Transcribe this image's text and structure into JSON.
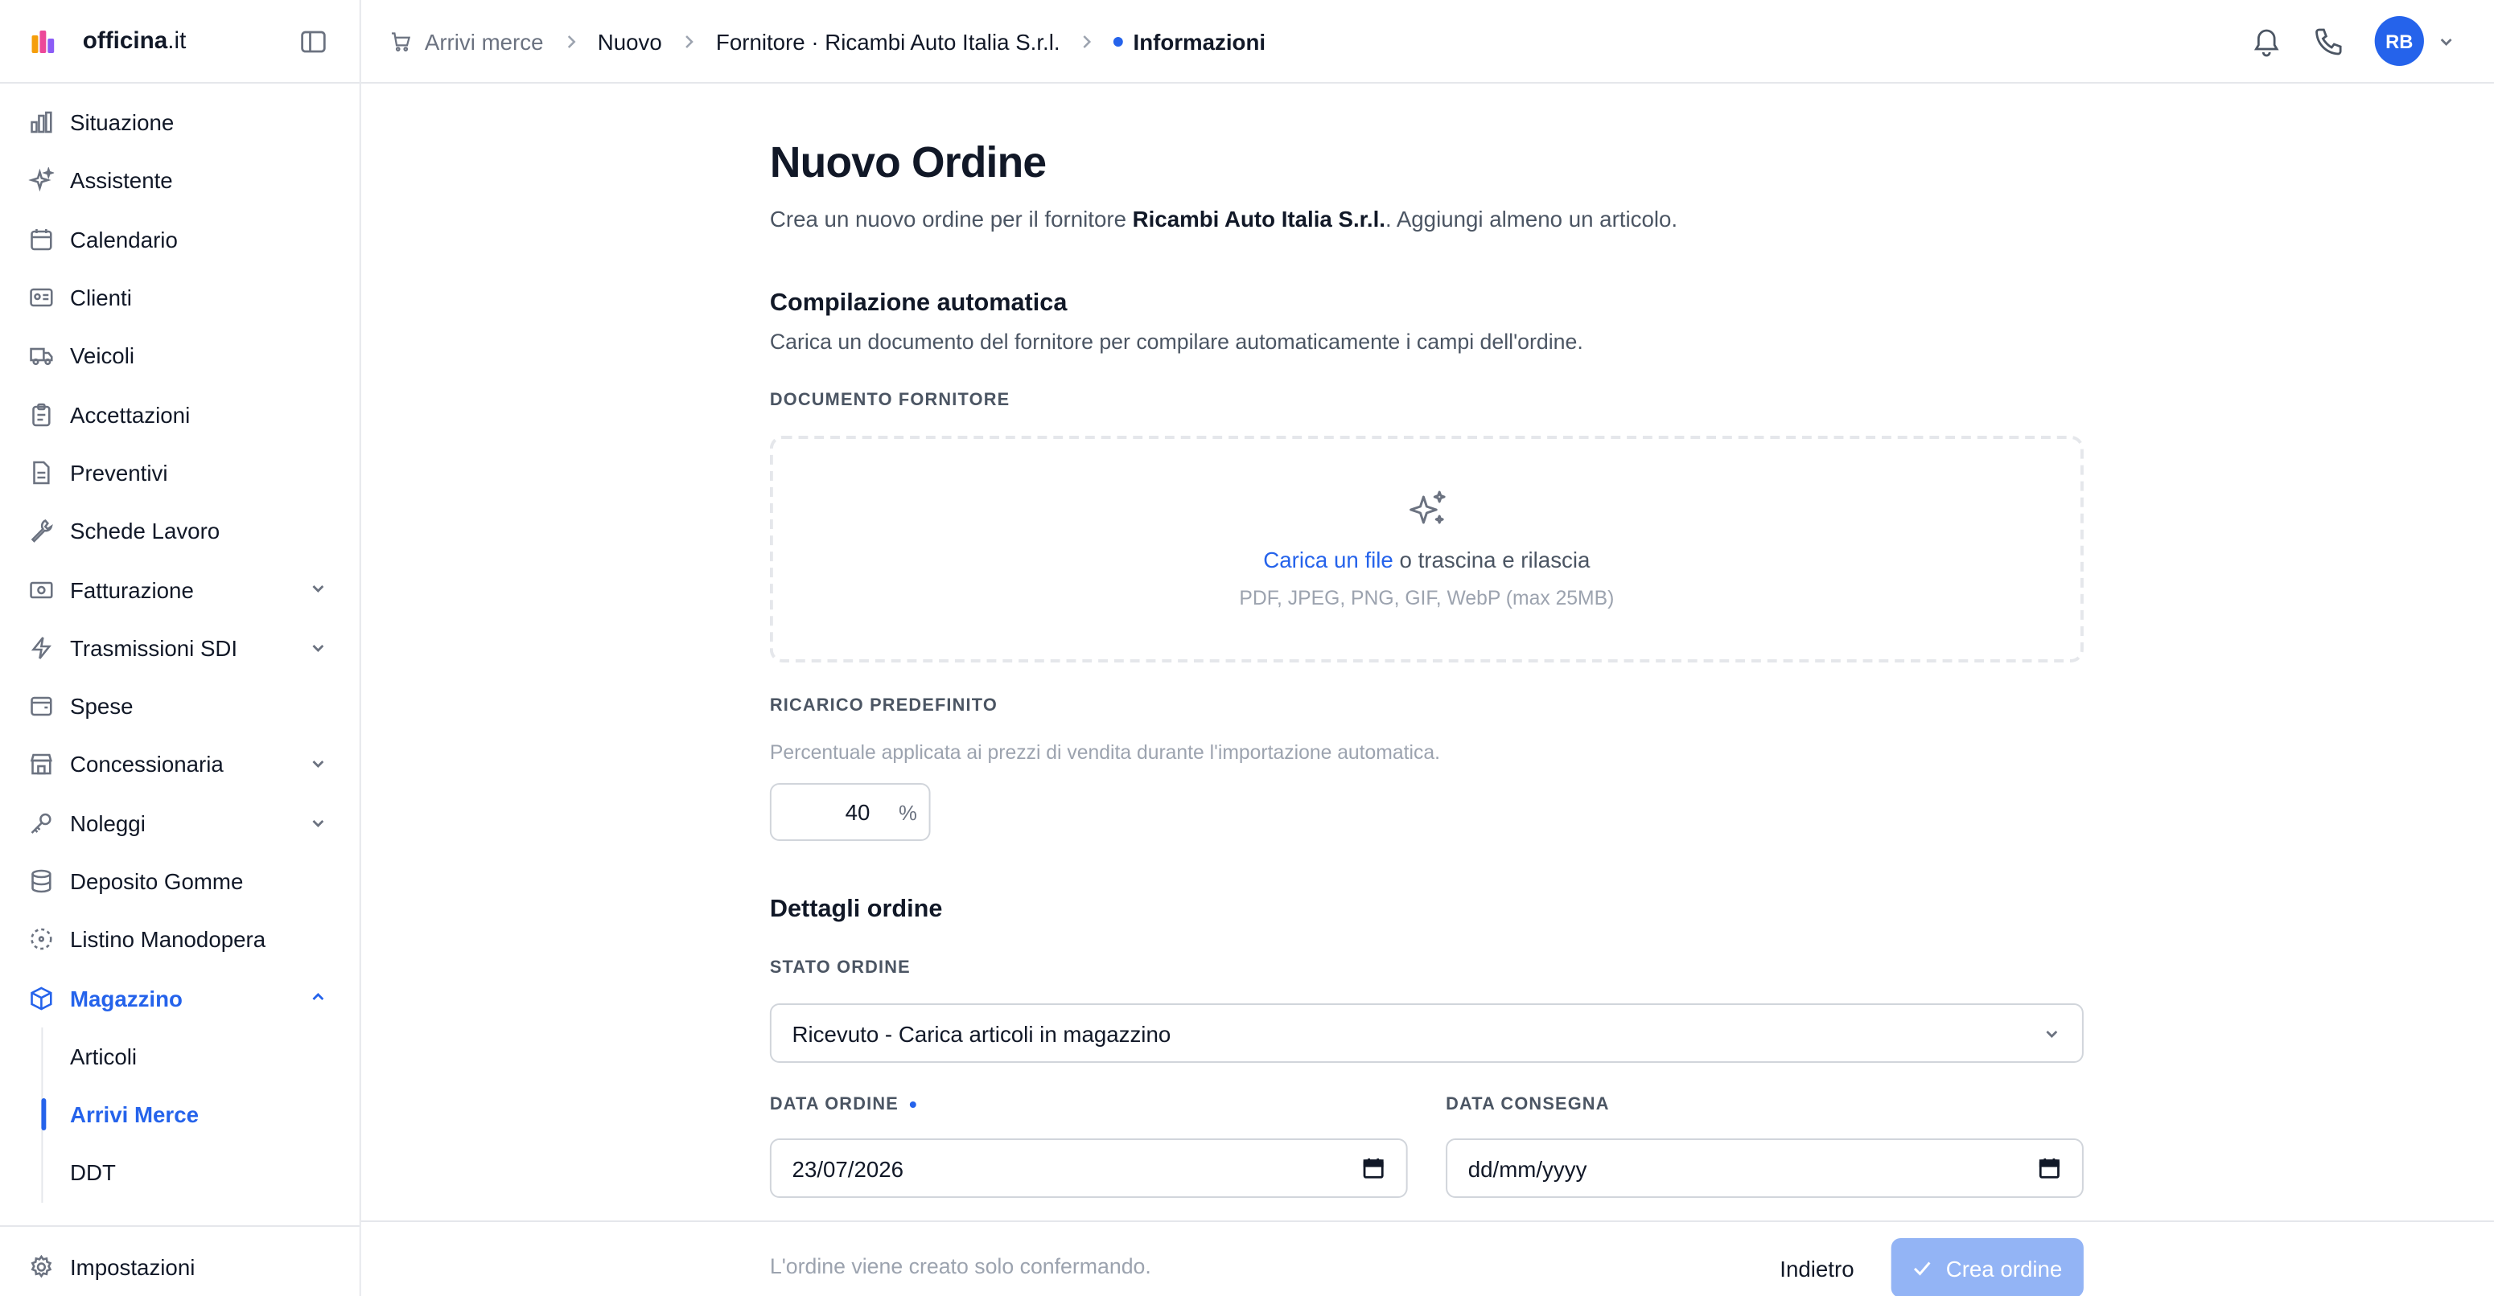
{
  "app": {
    "name": "officina",
    "tld": ".it"
  },
  "sidebar": {
    "items": [
      {
        "label": "Situazione",
        "icon": "bar-chart-icon"
      },
      {
        "label": "Assistente",
        "icon": "sparkles-icon"
      },
      {
        "label": "Calendario",
        "icon": "calendar-icon"
      },
      {
        "label": "Clienti",
        "icon": "id-card-icon"
      },
      {
        "label": "Veicoli",
        "icon": "truck-icon"
      },
      {
        "label": "Accettazioni",
        "icon": "clipboard-icon"
      },
      {
        "label": "Preventivi",
        "icon": "file-icon"
      },
      {
        "label": "Schede Lavoro",
        "icon": "wrench-icon"
      },
      {
        "label": "Fatturazione",
        "icon": "banknote-icon",
        "expandable": true
      },
      {
        "label": "Trasmissioni SDI",
        "icon": "bolt-icon",
        "expandable": true
      },
      {
        "label": "Spese",
        "icon": "wallet-icon"
      },
      {
        "label": "Concessionaria",
        "icon": "store-icon",
        "expandable": true
      },
      {
        "label": "Noleggi",
        "icon": "key-icon",
        "expandable": true
      },
      {
        "label": "Deposito Gomme",
        "icon": "database-icon"
      },
      {
        "label": "Listino Manodopera",
        "icon": "dashed-circle-icon"
      },
      {
        "label": "Magazzino",
        "icon": "box-icon",
        "expandable": true,
        "active": true
      }
    ],
    "magazzino_sub": [
      {
        "label": "Articoli"
      },
      {
        "label": "Arrivi Merce",
        "active": true
      },
      {
        "label": "DDT"
      }
    ],
    "footer_label": "Impostazioni"
  },
  "breadcrumb": {
    "items": [
      "Arrivi merce",
      "Nuovo",
      "Fornitore · Ricambi Auto Italia S.r.l."
    ],
    "current": "Informazioni"
  },
  "user": {
    "initials": "RB"
  },
  "page": {
    "title": "Nuovo Ordine",
    "subtitle_pre": "Crea un nuovo ordine per il fornitore ",
    "subtitle_supplier": "Ricambi Auto Italia S.r.l.",
    "subtitle_post": ". Aggiungi almeno un articolo."
  },
  "autofill": {
    "title": "Compilazione automatica",
    "description": "Carica un documento del fornitore per compilare automaticamente i campi dell'ordine.",
    "document_label": "DOCUMENTO FORNITORE",
    "upload_link": "Carica un file",
    "upload_rest": " o trascina e rilascia",
    "formats": "PDF, JPEG, PNG, GIF, WebP (max 25MB)",
    "markup_label": "RICARICO PREDEFINITO",
    "markup_hint": "Percentuale applicata ai prezzi di vendita durante l'importazione automatica.",
    "markup_value": "40",
    "markup_unit": "%"
  },
  "details": {
    "title": "Dettagli ordine",
    "status_label": "STATO ORDINE",
    "status_value": "Ricevuto - Carica articoli in magazzino",
    "order_date_label": "DATA ORDINE",
    "order_date_value": "23/07/2026",
    "delivery_date_label": "DATA CONSEGNA",
    "delivery_date_placeholder": "dd/mm/yyyy"
  },
  "footer": {
    "note": "L'ordine viene creato solo confermando.",
    "back_label": "Indietro",
    "create_label": "Crea ordine"
  },
  "colors": {
    "accent": "#2563eb",
    "accent_disabled": "#93b4f5",
    "border": "#e5e7eb"
  }
}
